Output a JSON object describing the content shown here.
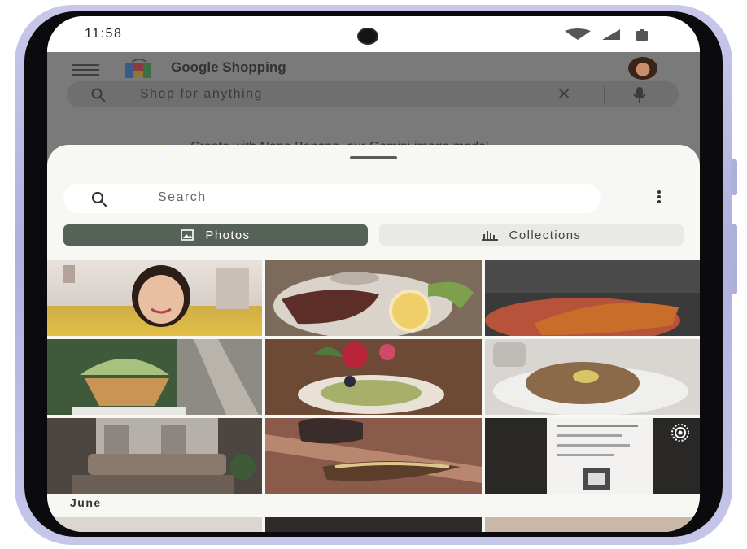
{
  "status_bar": {
    "time": "11:58"
  },
  "shopping_app": {
    "title": "Google Shopping",
    "search_placeholder": "Shop for anything",
    "banner_text": "Create with Nano Banana, our Gemini image model"
  },
  "picker": {
    "search_placeholder": "Search",
    "tabs": [
      {
        "label": "Photos",
        "selected": true
      },
      {
        "label": "Collections",
        "selected": false
      }
    ],
    "photos": [
      {
        "subject": "selfie-woman"
      },
      {
        "subject": "steak-plate"
      },
      {
        "subject": "corn-dish"
      },
      {
        "subject": "matcha-ice-cream"
      },
      {
        "subject": "salad-with-flowers"
      },
      {
        "subject": "bagel-plate"
      },
      {
        "subject": "living-room"
      },
      {
        "subject": "grilled-bread"
      },
      {
        "subject": "receipt",
        "badge_icon": "live-photo-icon"
      }
    ],
    "section_label": "June"
  },
  "colors": {
    "accent": "#566158",
    "frame": "#b8b9e2"
  }
}
